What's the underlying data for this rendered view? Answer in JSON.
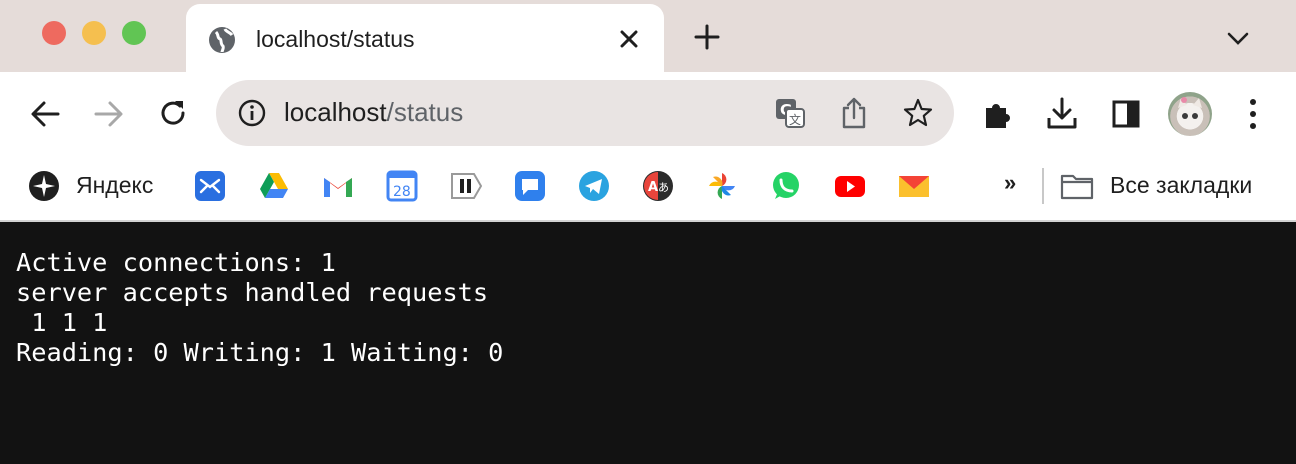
{
  "window": {
    "tab": {
      "title": "localhost/status"
    }
  },
  "toolbar": {
    "url_host": "localhost",
    "url_path": "/status"
  },
  "bookmarks": {
    "items": [
      {
        "label": "Яндекс",
        "icon": "yandex-icon"
      },
      {
        "label": "",
        "icon": "mail-app-icon"
      },
      {
        "label": "",
        "icon": "google-drive-icon"
      },
      {
        "label": "",
        "icon": "gmail-icon"
      },
      {
        "label": "28",
        "icon": "google-calendar-icon"
      },
      {
        "label": "",
        "icon": "pause-tag-icon"
      },
      {
        "label": "",
        "icon": "chat-icon"
      },
      {
        "label": "",
        "icon": "telegram-icon"
      },
      {
        "label": "",
        "icon": "translate-icon"
      },
      {
        "label": "",
        "icon": "google-photos-icon"
      },
      {
        "label": "",
        "icon": "whatsapp-icon"
      },
      {
        "label": "",
        "icon": "youtube-icon"
      },
      {
        "label": "",
        "icon": "yandex-mail-icon"
      }
    ],
    "more": "»",
    "all_bookmarks": "Все закладки"
  },
  "page": {
    "lines": [
      "Active connections: 1",
      "server accepts handled requests",
      " 1 1 1",
      "Reading: 0 Writing: 1 Waiting: 0"
    ]
  }
}
